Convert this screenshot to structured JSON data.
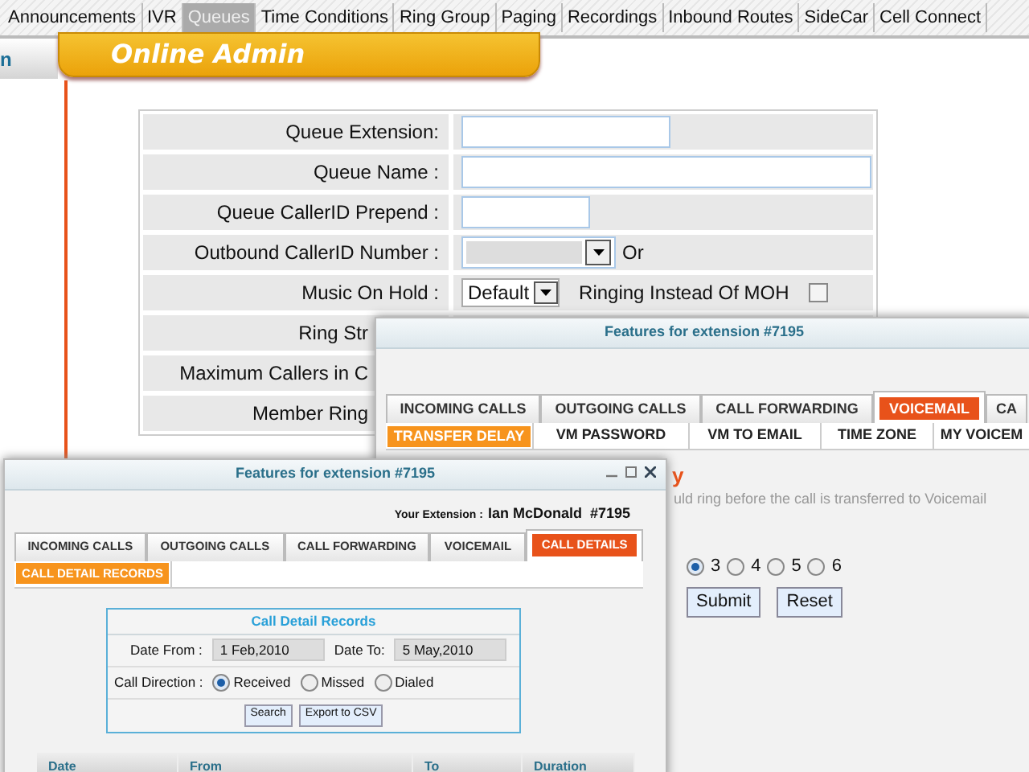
{
  "nav_tabs": [
    {
      "label": "Announcements",
      "selected": false
    },
    {
      "label": "IVR",
      "selected": false
    },
    {
      "label": "Queues",
      "selected": true
    },
    {
      "label": "Time Conditions",
      "selected": false
    },
    {
      "label": "Ring Group",
      "selected": false
    },
    {
      "label": "Paging",
      "selected": false
    },
    {
      "label": "Recordings",
      "selected": false
    },
    {
      "label": "Inbound Routes",
      "selected": false
    },
    {
      "label": "SideCar",
      "selected": false
    },
    {
      "label": "Cell Connect",
      "selected": false
    }
  ],
  "side_tab": {
    "label": "n"
  },
  "banner": {
    "title": "Online Admin"
  },
  "queue_form": {
    "rows": [
      {
        "label": "Queue Extension:",
        "kind": "short"
      },
      {
        "label": "Queue Name :",
        "kind": "long"
      },
      {
        "label": "Queue CallerID Prepend :",
        "kind": "tiny"
      },
      {
        "label": "Outbound CallerID Number :",
        "kind": "select_or",
        "suffix": "Or"
      },
      {
        "label": "Music On Hold :",
        "kind": "moh",
        "value": "Default",
        "option_label": "Ringing Instead Of MOH",
        "checked": false
      },
      {
        "label": "Ring Str",
        "kind": "hidden"
      },
      {
        "label": "Maximum Callers in C",
        "kind": "hidden"
      },
      {
        "label": "Member Ring",
        "kind": "hidden"
      }
    ]
  },
  "voicemail_window": {
    "title": "Features for extension #7195",
    "tabs": [
      {
        "label": "INCOMING CALLS",
        "selected": false
      },
      {
        "label": "OUTGOING CALLS",
        "selected": false
      },
      {
        "label": "CALL FORWARDING",
        "selected": false
      },
      {
        "label": "VOICEMAIL",
        "selected": true
      },
      {
        "label": "CA",
        "selected": false
      }
    ],
    "subtabs": [
      {
        "label": "TRANSFER DELAY",
        "selected": true
      },
      {
        "label": "VM PASSWORD",
        "selected": false
      },
      {
        "label": "VM TO EMAIL",
        "selected": false
      },
      {
        "label": "TIME ZONE",
        "selected": false
      },
      {
        "label": "MY VOICEM",
        "selected": false
      }
    ],
    "heading": "y",
    "description": "uld ring before the call is transferred to Voicemail",
    "rings": [
      {
        "label": "3",
        "selected": true
      },
      {
        "label": "4",
        "selected": false
      },
      {
        "label": "5",
        "selected": false
      },
      {
        "label": "6",
        "selected": false
      }
    ],
    "buttons": [
      "Submit",
      "Reset"
    ]
  },
  "cdr_window": {
    "title": "Features for extension #7195",
    "extension_label": "Your Extension :",
    "extension_value": "Ian McDonald  #7195",
    "tabs": [
      {
        "label": "INCOMING CALLS",
        "selected": false
      },
      {
        "label": "OUTGOING CALLS",
        "selected": false
      },
      {
        "label": "CALL FORWARDING",
        "selected": false
      },
      {
        "label": "VOICEMAIL",
        "selected": false
      },
      {
        "label": "CALL DETAILS",
        "selected": true
      }
    ],
    "subtabs": [
      {
        "label": "CALL DETAIL RECORDS",
        "selected": true
      }
    ],
    "panel": {
      "title": "Call Detail Records",
      "date_from_label": "Date From :",
      "date_from": "1 Feb,2010",
      "date_to_label": "Date To:",
      "date_to": "5 May,2010",
      "direction_label": "Call Direction :",
      "directions": [
        {
          "label": "Received",
          "selected": true
        },
        {
          "label": "Missed",
          "selected": false
        },
        {
          "label": "Dialed",
          "selected": false
        }
      ],
      "buttons": [
        "Search",
        "Export to CSV"
      ]
    },
    "table": {
      "columns": [
        "Date",
        "From",
        "To",
        "Duration"
      ]
    }
  }
}
